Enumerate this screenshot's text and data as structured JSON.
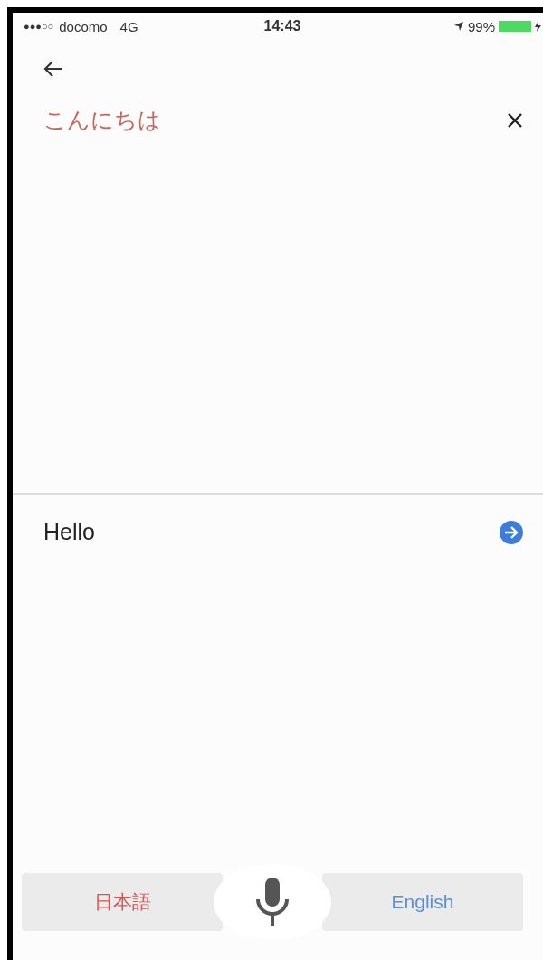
{
  "status_bar": {
    "signal_dots": "●●●○○",
    "carrier": "docomo",
    "network": "4G",
    "time": "14:43",
    "battery_percent": "99%",
    "battery": {
      "level": 0.99
    }
  },
  "source": {
    "text": "こんにちは"
  },
  "result": {
    "text": "Hello"
  },
  "languages": [
    {
      "label": "日本語",
      "color": "#d9534f"
    },
    {
      "label": "English",
      "color": "#5b8fd6"
    }
  ]
}
